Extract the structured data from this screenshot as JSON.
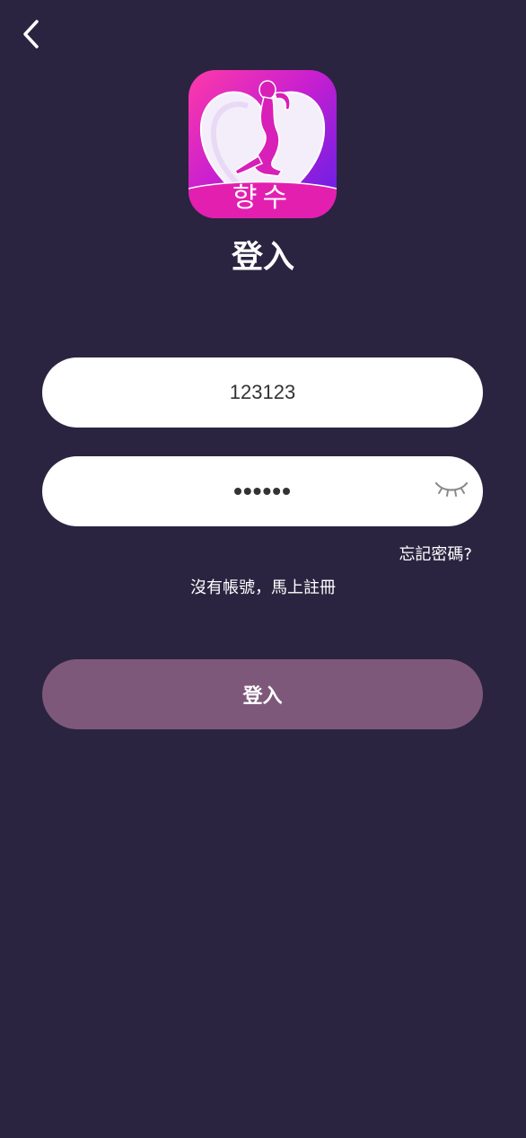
{
  "header": {
    "back_icon": "chevron-left-icon"
  },
  "logo": {
    "text": "향수"
  },
  "page": {
    "title": "登入"
  },
  "form": {
    "username_value": "123123",
    "password_value": "123123",
    "password_toggle_icon": "eye-closed-icon",
    "forgot_password_label": "忘記密碼?",
    "register_label": "沒有帳號，馬上註冊",
    "login_button_label": "登入"
  },
  "colors": {
    "background": "#2a2440",
    "login_button": "#7e587a",
    "logo_gradient_start": "#ff3aa8",
    "logo_gradient_end": "#5d1fe8"
  }
}
